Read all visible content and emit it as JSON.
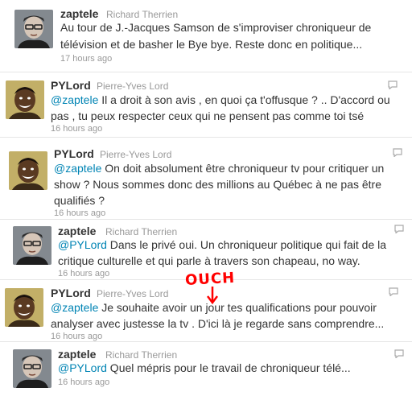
{
  "tweets": [
    {
      "username": "zaptele",
      "fullname": "Richard Therrien",
      "line1": "Au tour de J.-Jacques Samson de s'improviser chroniqueur de",
      "line2": "télévision et de basher le Bye bye. Reste donc en politique...",
      "time": "17 hours ago"
    },
    {
      "username": "PYLord",
      "fullname": "Pierre-Yves Lord",
      "mention": "@zaptele",
      "line1": " Il a droit à son avis , en quoi ça t'offusque ? .. D'accord ou",
      "line2": "pas , tu peux respecter ceux qui ne pensent pas comme toi tsé",
      "time": "16 hours ago"
    },
    {
      "username": "PYLord",
      "fullname": "Pierre-Yves Lord",
      "mention": "@zaptele",
      "line1": " On doit absolument être chroniqueur tv pour critiquer un",
      "line2": "show ? Nous sommes donc des millions au Québec à ne pas être",
      "line3": "qualifiés ?",
      "time": "16 hours ago"
    },
    {
      "username": "zaptele",
      "fullname": "Richard Therrien",
      "mention": "@PYLord",
      "line1": " Dans le privé oui. Un chroniqueur politique qui fait de la",
      "line2": "critique culturelle et qui parle à travers son chapeau, no way.",
      "time": "16 hours ago"
    },
    {
      "username": "PYLord",
      "fullname": "Pierre-Yves Lord",
      "mention": "@zaptele",
      "line1": " Je souhaite avoir un jour tes qualifications pour pouvoir",
      "line2": "analyser avec justesse la tv . D'ici là je regarde sans comprendre...",
      "time": "16 hours ago"
    },
    {
      "username": "zaptele",
      "fullname": "Richard Therrien",
      "mention": "@PYLord",
      "line1": " Quel mépris pour le travail de chroniqueur télé...",
      "time": "16 hours ago"
    }
  ],
  "annotation": {
    "text": "OUCH",
    "color": "#ff0000"
  },
  "colors": {
    "mention": "#0084b4",
    "username": "#333333",
    "meta": "#999999"
  }
}
